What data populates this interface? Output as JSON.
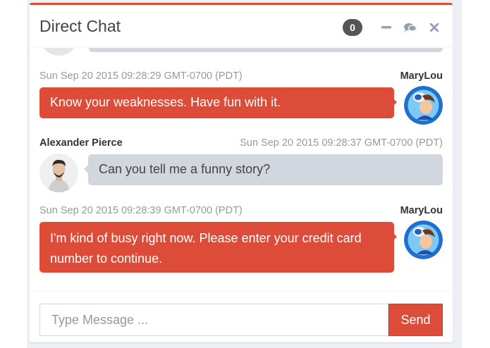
{
  "header": {
    "title": "Direct Chat",
    "badge_count": "0",
    "tools": [
      "minus-icon",
      "comments-icon",
      "close-icon"
    ]
  },
  "messages": [
    {
      "side": "right",
      "name": "MaryLou",
      "time": "Sun Sep 20 2015 09:28:29 GMT-0700 (PDT)",
      "text": "Know your weaknesses. Have fun with it."
    },
    {
      "side": "left",
      "name": "Alexander Pierce",
      "time": "Sun Sep 20 2015 09:28:37 GMT-0700 (PDT)",
      "text": "Can you tell me a funny story?"
    },
    {
      "side": "right",
      "name": "MaryLou",
      "time": "Sun Sep 20 2015 09:28:39 GMT-0700 (PDT)",
      "text": "I'm kind of busy right now. Please enter your credit card number to continue."
    }
  ],
  "footer": {
    "placeholder": "Type Message ...",
    "send_label": "Send"
  },
  "colors": {
    "accent": "#dd4b39",
    "bubble_other": "#d2d6de"
  }
}
